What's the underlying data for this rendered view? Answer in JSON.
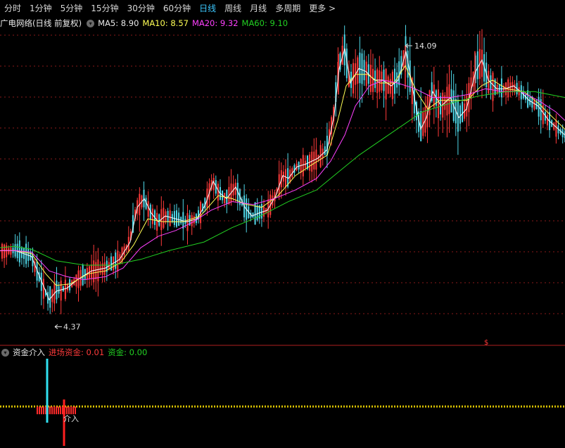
{
  "tabs": [
    {
      "label": "分时",
      "active": false
    },
    {
      "label": "1分钟",
      "active": false
    },
    {
      "label": "5分钟",
      "active": false
    },
    {
      "label": "15分钟",
      "active": false
    },
    {
      "label": "30分钟",
      "active": false
    },
    {
      "label": "60分钟",
      "active": false
    },
    {
      "label": "日线",
      "active": true
    },
    {
      "label": "周线",
      "active": false
    },
    {
      "label": "月线",
      "active": false
    },
    {
      "label": "多周期",
      "active": false
    },
    {
      "label": "更多 >",
      "active": false
    }
  ],
  "info": {
    "stock_title": "广电网络(日线 前复权)",
    "ma5": "MA5: 8.90",
    "ma10": "MA10: 8.57",
    "ma20": "MA20: 9.32",
    "ma60": "MA60: 9.10"
  },
  "indicator": {
    "name": "资金介入",
    "entry_fund": "进场资金: 0.01",
    "fund": "资金: 0.00",
    "marker_label": "介入"
  },
  "colors": {
    "up": "#ff3a3a",
    "down": "#4fd7e8",
    "ma5": "#ffffff",
    "ma10": "#ffff55",
    "ma20": "#ff40ff",
    "ma60": "#22d022",
    "grid": "#8a1a1a",
    "dotted": "#d8c000"
  },
  "chart_data": {
    "type": "candlestick",
    "ylim": [
      3.8,
      14.6
    ],
    "high_label": "14.09",
    "low_label": "4.37",
    "ma_series": [
      {
        "name": "MA5",
        "points": [
          [
            0,
            7.0
          ],
          [
            22,
            7.0
          ],
          [
            45,
            6.8
          ],
          [
            58,
            6.0
          ],
          [
            70,
            5.3
          ],
          [
            80,
            5.6
          ],
          [
            95,
            5.7
          ],
          [
            110,
            6.0
          ],
          [
            130,
            6.3
          ],
          [
            150,
            6.4
          ],
          [
            170,
            6.7
          ],
          [
            185,
            7.3
          ],
          [
            195,
            8.5
          ],
          [
            205,
            8.8
          ],
          [
            215,
            8.3
          ],
          [
            225,
            8.0
          ],
          [
            235,
            8.2
          ],
          [
            250,
            8.1
          ],
          [
            265,
            8.0
          ],
          [
            280,
            8.1
          ],
          [
            292,
            8.6
          ],
          [
            303,
            9.4
          ],
          [
            312,
            9.0
          ],
          [
            322,
            8.8
          ],
          [
            335,
            9.2
          ],
          [
            348,
            8.5
          ],
          [
            358,
            8.2
          ],
          [
            368,
            8.3
          ],
          [
            380,
            8.4
          ],
          [
            392,
            8.9
          ],
          [
            402,
            9.6
          ],
          [
            410,
            9.5
          ],
          [
            422,
            9.9
          ],
          [
            435,
            10.0
          ],
          [
            452,
            10.2
          ],
          [
            465,
            10.5
          ],
          [
            475,
            11.7
          ],
          [
            482,
            13.3
          ],
          [
            490,
            14.0
          ],
          [
            498,
            12.8
          ],
          [
            510,
            13.3
          ],
          [
            520,
            13.2
          ],
          [
            532,
            12.9
          ],
          [
            544,
            12.9
          ],
          [
            556,
            12.7
          ],
          [
            566,
            12.9
          ],
          [
            577,
            13.9
          ],
          [
            588,
            12.4
          ],
          [
            598,
            11.2
          ],
          [
            606,
            11.6
          ],
          [
            615,
            12.5
          ],
          [
            627,
            12.0
          ],
          [
            640,
            12.3
          ],
          [
            652,
            11.6
          ],
          [
            663,
            11.9
          ],
          [
            676,
            13.2
          ],
          [
            685,
            13.6
          ],
          [
            694,
            12.9
          ],
          [
            706,
            12.6
          ],
          [
            718,
            12.6
          ],
          [
            730,
            12.7
          ],
          [
            740,
            12.5
          ],
          [
            752,
            12.2
          ],
          [
            765,
            12.0
          ],
          [
            780,
            11.5
          ],
          [
            803,
            11.0
          ]
        ]
      },
      {
        "name": "MA10",
        "points": [
          [
            0,
            7.0
          ],
          [
            22,
            7.0
          ],
          [
            45,
            6.9
          ],
          [
            65,
            6.2
          ],
          [
            80,
            5.8
          ],
          [
            100,
            5.85
          ],
          [
            125,
            6.2
          ],
          [
            150,
            6.3
          ],
          [
            172,
            6.6
          ],
          [
            190,
            7.2
          ],
          [
            210,
            8.1
          ],
          [
            232,
            8.0
          ],
          [
            260,
            8.0
          ],
          [
            285,
            8.2
          ],
          [
            310,
            8.9
          ],
          [
            330,
            8.8
          ],
          [
            350,
            8.6
          ],
          [
            372,
            8.5
          ],
          [
            395,
            8.9
          ],
          [
            420,
            9.6
          ],
          [
            445,
            10.0
          ],
          [
            465,
            10.3
          ],
          [
            480,
            11.5
          ],
          [
            492,
            12.7
          ],
          [
            505,
            13.1
          ],
          [
            522,
            13.1
          ],
          [
            540,
            12.8
          ],
          [
            560,
            12.8
          ],
          [
            576,
            13.4
          ],
          [
            592,
            12.5
          ],
          [
            608,
            11.9
          ],
          [
            625,
            12.2
          ],
          [
            645,
            12.2
          ],
          [
            664,
            12.2
          ],
          [
            684,
            12.7
          ],
          [
            700,
            12.9
          ],
          [
            720,
            12.6
          ],
          [
            745,
            12.5
          ],
          [
            765,
            12.1
          ],
          [
            803,
            11.2
          ]
        ]
      },
      {
        "name": "MA20",
        "points": [
          [
            0,
            7.0
          ],
          [
            22,
            7.0
          ],
          [
            45,
            6.95
          ],
          [
            70,
            6.3
          ],
          [
            95,
            6.1
          ],
          [
            120,
            6.0
          ],
          [
            150,
            6.1
          ],
          [
            175,
            6.4
          ],
          [
            200,
            7.1
          ],
          [
            225,
            7.5
          ],
          [
            250,
            7.7
          ],
          [
            275,
            8.0
          ],
          [
            300,
            8.4
          ],
          [
            330,
            8.7
          ],
          [
            360,
            8.6
          ],
          [
            390,
            8.8
          ],
          [
            420,
            9.1
          ],
          [
            450,
            9.5
          ],
          [
            470,
            10.1
          ],
          [
            490,
            11.0
          ],
          [
            505,
            12.0
          ],
          [
            525,
            12.7
          ],
          [
            545,
            12.9
          ],
          [
            565,
            12.8
          ],
          [
            590,
            12.6
          ],
          [
            615,
            12.3
          ],
          [
            640,
            12.3
          ],
          [
            665,
            12.4
          ],
          [
            690,
            12.6
          ],
          [
            715,
            12.5
          ],
          [
            740,
            12.5
          ],
          [
            765,
            12.2
          ],
          [
            790,
            11.8
          ],
          [
            803,
            11.5
          ]
        ]
      },
      {
        "name": "MA60",
        "points": [
          [
            0,
            7.1
          ],
          [
            20,
            7.15
          ],
          [
            45,
            7.05
          ],
          [
            80,
            6.65
          ],
          [
            120,
            6.5
          ],
          [
            160,
            6.5
          ],
          [
            200,
            6.7
          ],
          [
            240,
            7.0
          ],
          [
            290,
            7.3
          ],
          [
            330,
            7.8
          ],
          [
            370,
            8.2
          ],
          [
            410,
            8.7
          ],
          [
            450,
            9.1
          ],
          [
            480,
            9.7
          ],
          [
            510,
            10.3
          ],
          [
            540,
            10.8
          ],
          [
            570,
            11.3
          ],
          [
            600,
            11.8
          ],
          [
            640,
            12.1
          ],
          [
            680,
            12.35
          ],
          [
            720,
            12.5
          ],
          [
            760,
            12.5
          ],
          [
            803,
            12.3
          ]
        ]
      }
    ],
    "marker_high": {
      "x": 576,
      "value": 14.09
    },
    "marker_low": {
      "x": 78,
      "value": 4.37
    }
  },
  "indicator_data": {
    "cyan_bar": {
      "x": 67
    },
    "red_bar": {
      "x": 91
    },
    "red_band": {
      "x_start": 52,
      "x_end": 106
    }
  }
}
